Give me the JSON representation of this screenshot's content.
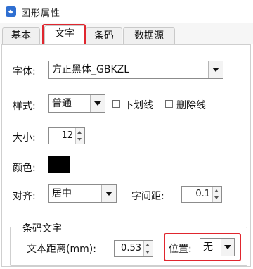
{
  "window": {
    "title": "图形属性",
    "icon": "app-icon"
  },
  "tabs": [
    {
      "label": "基本",
      "active": false
    },
    {
      "label": "文字",
      "active": true
    },
    {
      "label": "条码",
      "active": false
    },
    {
      "label": "数据源",
      "active": false
    }
  ],
  "form": {
    "font": {
      "label": "字体:",
      "value": "方正黑体_GBKZL"
    },
    "style": {
      "label": "样式:",
      "value": "普通",
      "underline_label": "下划线",
      "underline_checked": false,
      "strike_label": "删除线",
      "strike_checked": false
    },
    "size": {
      "label": "大小:",
      "value": "12"
    },
    "color": {
      "label": "颜色:",
      "value": "#000000"
    },
    "align": {
      "label": "对齐:",
      "value": "居中"
    },
    "spacing": {
      "label": "字间距:",
      "value": "0.1"
    }
  },
  "barcode_text": {
    "group_title": "条码文字",
    "distance_label": "文本距离(mm):",
    "distance_value": "0.53",
    "position_label": "位置:",
    "position_value": "无"
  },
  "colors": {
    "highlight": "#e0262e",
    "accent": "#2f6fd1"
  }
}
